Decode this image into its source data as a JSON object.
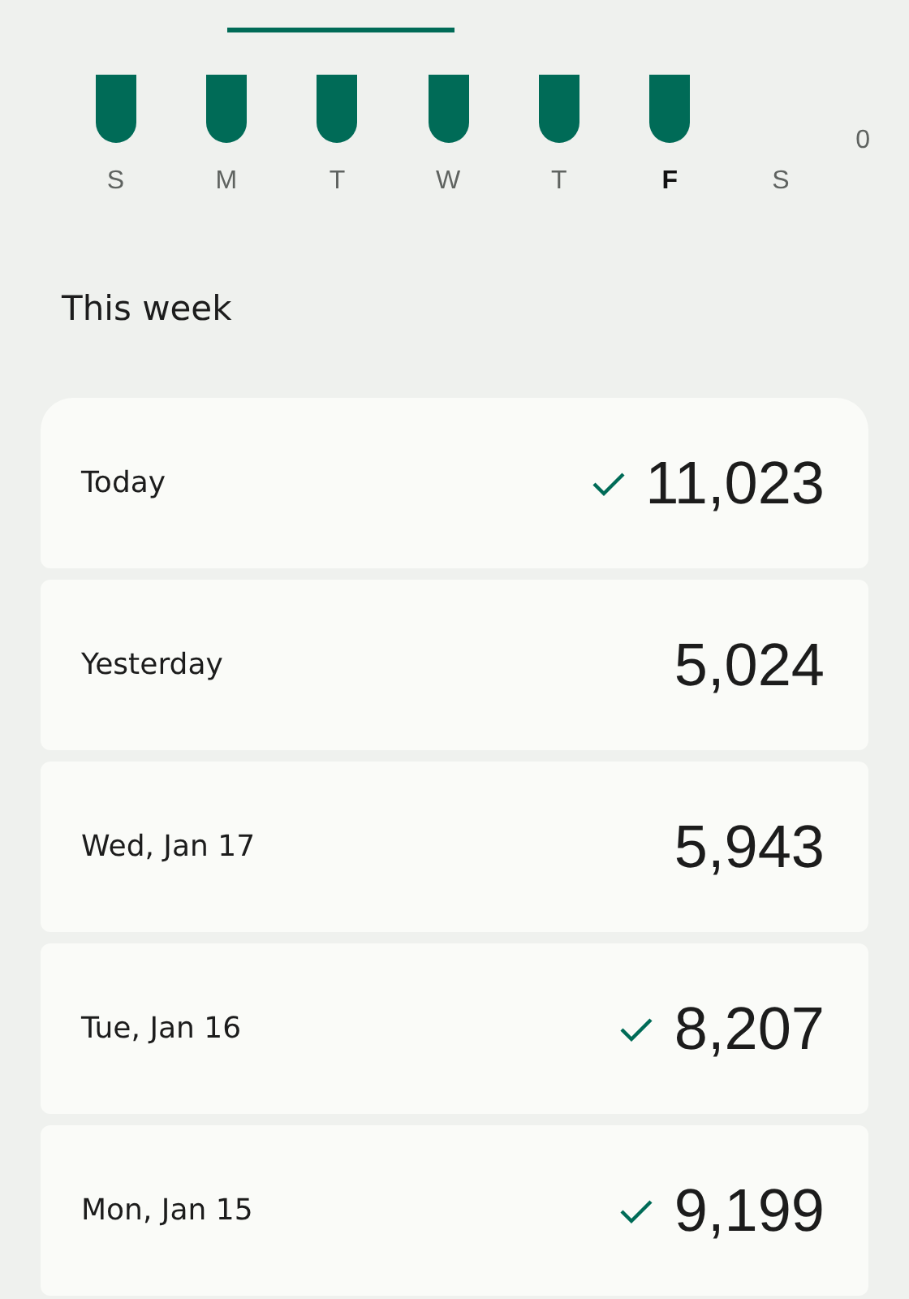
{
  "chart": {
    "axis_label": "0",
    "days": [
      {
        "label": "S",
        "has_bar": true,
        "selected": false
      },
      {
        "label": "M",
        "has_bar": true,
        "selected": false
      },
      {
        "label": "T",
        "has_bar": true,
        "selected": false
      },
      {
        "label": "W",
        "has_bar": true,
        "selected": false
      },
      {
        "label": "T",
        "has_bar": true,
        "selected": false
      },
      {
        "label": "F",
        "has_bar": true,
        "selected": true
      },
      {
        "label": "S",
        "has_bar": false,
        "selected": false
      }
    ]
  },
  "section_title": "This week",
  "days": [
    {
      "label": "Today",
      "steps": "11,023",
      "goal_met": true
    },
    {
      "label": "Yesterday",
      "steps": "5,024",
      "goal_met": false
    },
    {
      "label": "Wed, Jan 17",
      "steps": "5,943",
      "goal_met": false
    },
    {
      "label": "Tue, Jan 16",
      "steps": "8,207",
      "goal_met": true
    },
    {
      "label": "Mon, Jan 15",
      "steps": "9,199",
      "goal_met": true
    }
  ]
}
